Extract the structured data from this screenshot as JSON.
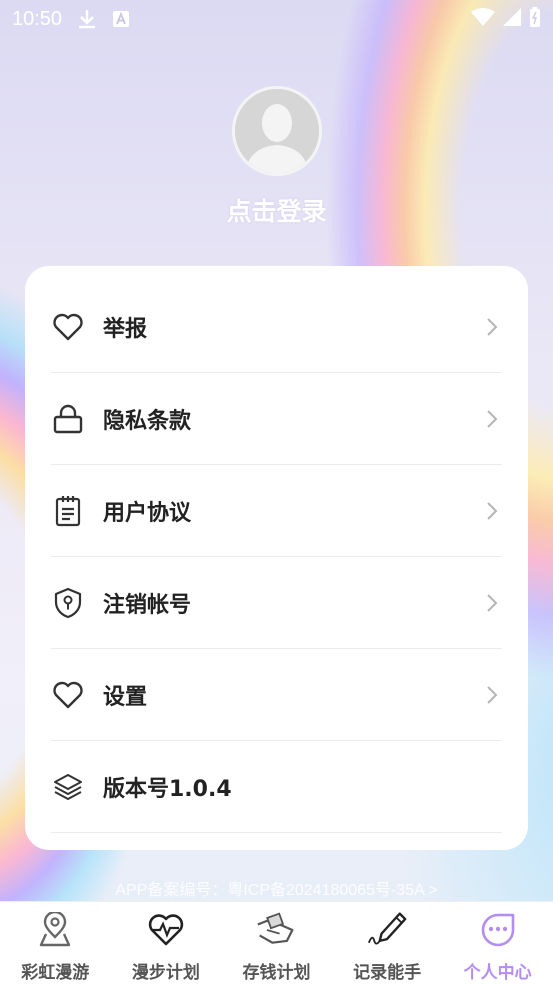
{
  "status_bar": {
    "time": "10:50",
    "icons": [
      "download-icon",
      "a-notification-icon",
      "wifi-icon",
      "signal-icon",
      "battery-icon"
    ]
  },
  "profile": {
    "avatar": "default-avatar",
    "login_text": "点击登录"
  },
  "menu": [
    {
      "icon": "heart-icon",
      "label": "举报",
      "has_chevron": true
    },
    {
      "icon": "lock-icon",
      "label": "隐私条款",
      "has_chevron": true
    },
    {
      "icon": "clipboard-icon",
      "label": "用户协议",
      "has_chevron": true
    },
    {
      "icon": "shield-key-icon",
      "label": "注销帐号",
      "has_chevron": true
    },
    {
      "icon": "heart-icon",
      "label": "设置",
      "has_chevron": true
    },
    {
      "icon": "layers-icon",
      "label": "版本号1.0.4",
      "has_chevron": false
    }
  ],
  "beian": "APP备案编号：粤ICP备2024180065号-35A >",
  "nav": {
    "tabs": [
      {
        "label": "彩虹漫游",
        "icon": "map-pin-icon"
      },
      {
        "label": "漫步计划",
        "icon": "heart-pulse-icon"
      },
      {
        "label": "存钱计划",
        "icon": "hand-money-icon"
      },
      {
        "label": "记录能手",
        "icon": "pen-signature-icon"
      },
      {
        "label": "个人中心",
        "icon": "smiley-chat-icon",
        "active": true
      }
    ],
    "active_color": "#b48df2",
    "inactive_color": "#555555"
  }
}
